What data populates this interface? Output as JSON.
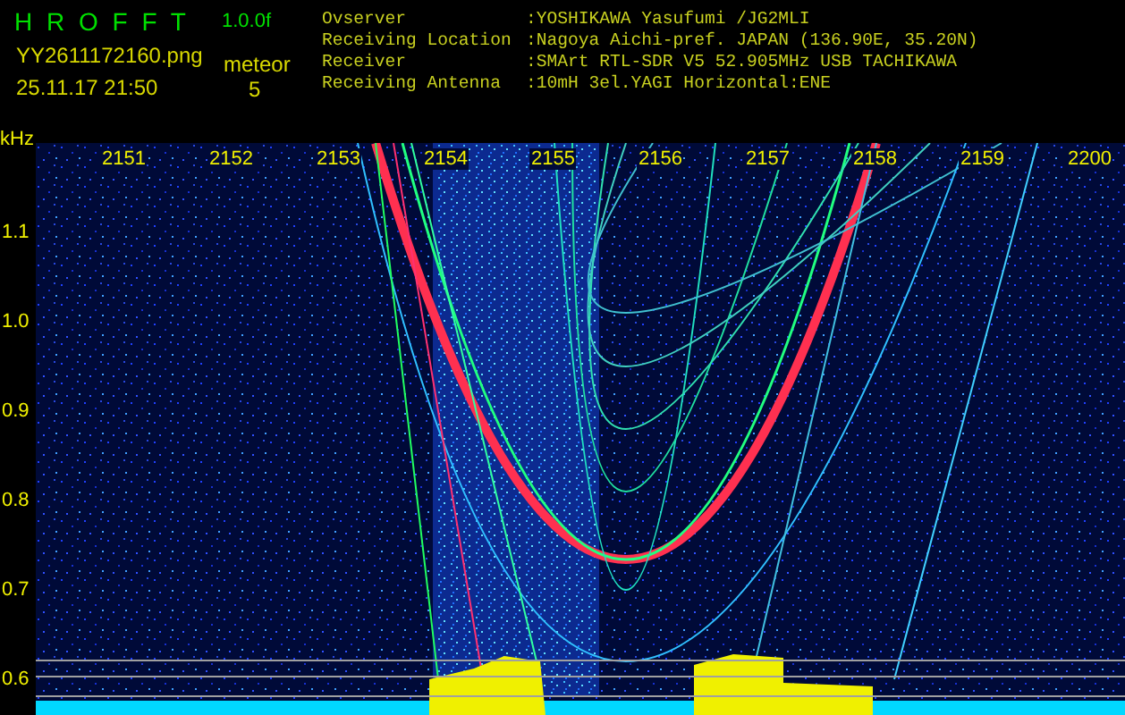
{
  "header": {
    "app_title": "H R O F F T",
    "version": "1.0.0f",
    "filename": "YY2611172160.png",
    "datetime": "25.11.17 21:50",
    "mode": "meteor",
    "count": "5"
  },
  "station_info": [
    {
      "label": "Ovserver",
      "value": ":YOSHIKAWA Yasufumi /JG2MLI"
    },
    {
      "label": "Receiving Location",
      "value": ":Nagoya Aichi-pref. JAPAN (136.90E, 35.20N)"
    },
    {
      "label": "Receiver",
      "value": ":SMArt RTL-SDR V5 52.905MHz USB TACHIKAWA"
    },
    {
      "label": "Receiving Antenna",
      "value": ":10mH 3el.YAGI Horizontal:ENE"
    }
  ],
  "spectrogram": {
    "y_unit": "kHz",
    "y_labels": [
      "1.1",
      "1.0",
      "0.9",
      "0.8",
      "0.7",
      "0.6"
    ],
    "x_labels": [
      "2151",
      "2152",
      "2153",
      "2154",
      "2155",
      "2156",
      "2157",
      "2158",
      "2159",
      "2200"
    ]
  }
}
